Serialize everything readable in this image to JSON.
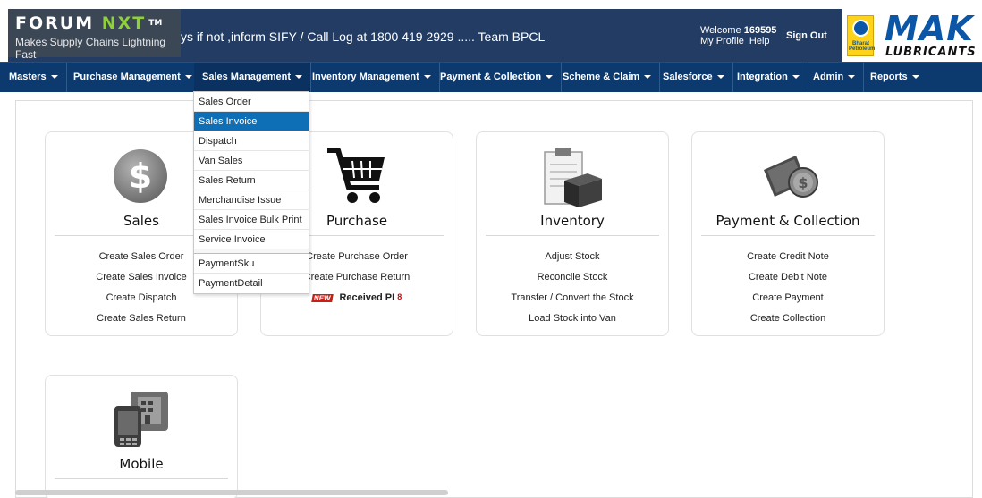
{
  "header": {
    "logo_main_a": "FORUM ",
    "logo_main_b": "NXT",
    "logo_tm": "TM",
    "logo_tagline": "Makes Supply Chains Lightning Fast",
    "marquee": "ys if not ,inform SIFY / Call Log at 1800 419 2929 ..... Team BPCL",
    "welcome_label": "Welcome",
    "welcome_user": "169595",
    "my_profile": "My Profile",
    "help": "Help",
    "sign_out": "Sign Out",
    "brand_mak": "MAK",
    "brand_lubricants": "LUBRICANTS",
    "bpcl_text": "Bharat Petroleum"
  },
  "nav": [
    {
      "label": "Masters"
    },
    {
      "label": "Purchase Management"
    },
    {
      "label": "Sales Management"
    },
    {
      "label": "Inventory Management"
    },
    {
      "label": "Payment & Collection"
    },
    {
      "label": "Scheme & Claim"
    },
    {
      "label": "Salesforce"
    },
    {
      "label": "Integration"
    },
    {
      "label": "Admin"
    },
    {
      "label": "Reports"
    }
  ],
  "sales_menu": {
    "items": [
      "Sales Order",
      "Sales Invoice",
      "Dispatch",
      "Van Sales",
      "Sales Return",
      "Merchandise Issue",
      "Sales Invoice Bulk Print",
      "Service Invoice",
      "PaymentSku",
      "PaymentDetail"
    ],
    "selected": "Sales Invoice"
  },
  "cards": {
    "sales": {
      "title": "Sales",
      "links": [
        "Create Sales Order",
        "Create Sales Invoice",
        "Create Dispatch",
        "Create Sales Return"
      ]
    },
    "purchase": {
      "title": "Purchase",
      "links": [
        "Create Purchase Order",
        "Create Purchase Return"
      ],
      "badge": "NEW",
      "received_label": "Received PI",
      "received_count": "8"
    },
    "inventory": {
      "title": "Inventory",
      "links": [
        "Adjust Stock",
        "Reconcile Stock",
        "Transfer / Convert the Stock",
        "Load Stock into Van"
      ]
    },
    "payment": {
      "title": "Payment & Collection",
      "links": [
        "Create Credit Note",
        "Create Debit Note",
        "Create Payment",
        "Create Collection"
      ]
    },
    "mobile": {
      "title": "Mobile"
    }
  },
  "colors": {
    "header_bg": "#223c63",
    "nav_bg": "#0d3a6e",
    "menu_selected": "#0e6fb6",
    "logo_accent": "#8fd13a",
    "brand_blue": "#0c56a8"
  }
}
